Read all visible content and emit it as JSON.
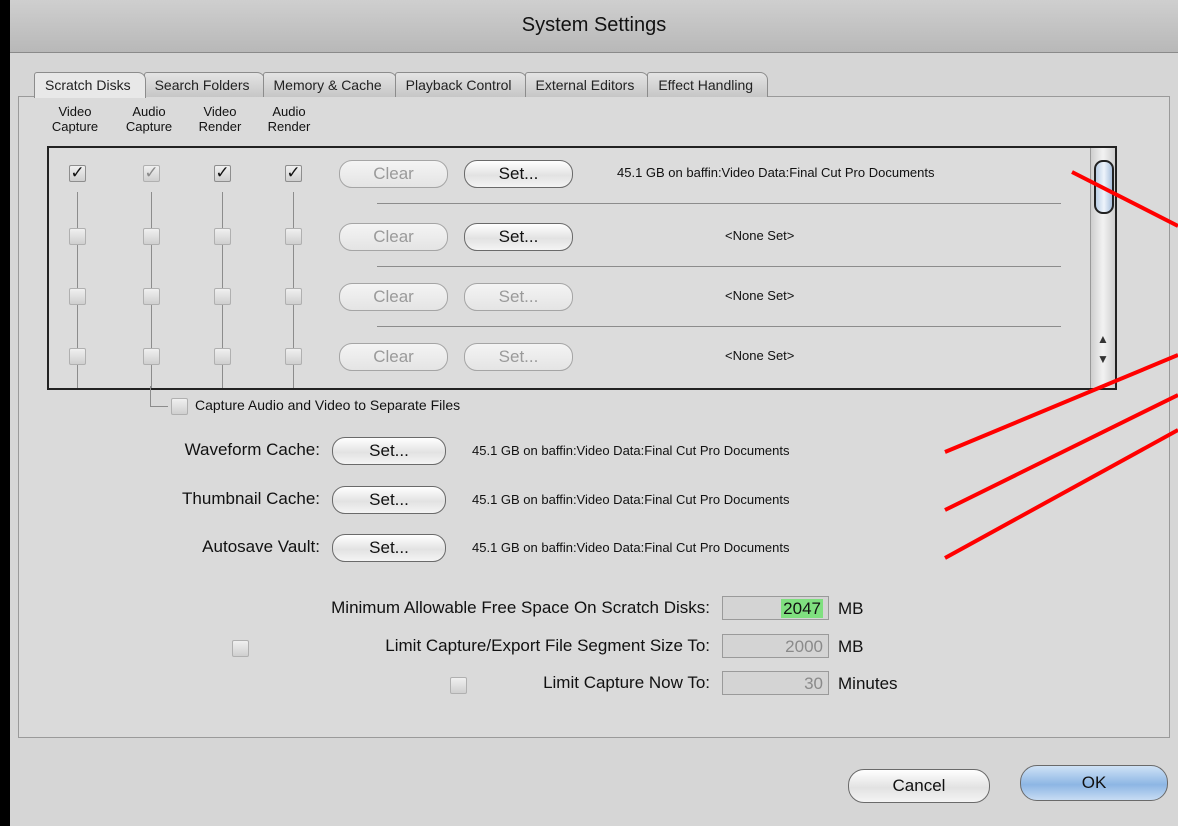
{
  "window": {
    "title": "System Settings"
  },
  "tabs": [
    {
      "label": "Scratch Disks",
      "active": true
    },
    {
      "label": "Search Folders"
    },
    {
      "label": "Memory & Cache"
    },
    {
      "label": "Playback Control"
    },
    {
      "label": "External Editors"
    },
    {
      "label": "Effect Handling"
    }
  ],
  "columns": [
    {
      "line1": "Video",
      "line2": "Capture"
    },
    {
      "line1": "Audio",
      "line2": "Capture"
    },
    {
      "line1": "Video",
      "line2": "Render"
    },
    {
      "line1": "Audio",
      "line2": "Render"
    }
  ],
  "scratch_rows": [
    {
      "checks": [
        true,
        true,
        true,
        true
      ],
      "check_disabled": [
        false,
        true,
        false,
        false
      ],
      "clear_label": "Clear",
      "set_label": "Set...",
      "set_enabled": true,
      "path": "45.1 GB on  baffin:Video Data:Final Cut Pro Documents"
    },
    {
      "checks": [
        false,
        false,
        false,
        false
      ],
      "clear_label": "Clear",
      "set_label": "Set...",
      "set_enabled": true,
      "path": "<None Set>"
    },
    {
      "checks": [
        false,
        false,
        false,
        false
      ],
      "clear_label": "Clear",
      "set_label": "Set...",
      "set_enabled": false,
      "path": "<None Set>"
    },
    {
      "checks": [
        false,
        false,
        false,
        false
      ],
      "clear_label": "Clear",
      "set_label": "Set...",
      "set_enabled": false,
      "path": "<None Set>"
    }
  ],
  "separate_files": {
    "label": "Capture Audio and Video to Separate Files",
    "checked": false
  },
  "caches": [
    {
      "label": "Waveform Cache:",
      "set_label": "Set...",
      "path": "45.1 GB on  baffin:Video Data:Final Cut Pro Documents"
    },
    {
      "label": "Thumbnail Cache:",
      "set_label": "Set...",
      "path": "45.1 GB on  baffin:Video Data:Final Cut Pro Documents"
    },
    {
      "label": "Autosave Vault:",
      "set_label": "Set...",
      "path": "45.1 GB on  baffin:Video Data:Final Cut Pro Documents"
    }
  ],
  "limits": {
    "min_free": {
      "label": "Minimum Allowable Free Space On Scratch Disks:",
      "value": "2047",
      "unit": "MB"
    },
    "segment": {
      "label": "Limit Capture/Export File Segment Size To:",
      "value": "2000",
      "unit": "MB",
      "checked": false
    },
    "capture_now": {
      "label": "Limit Capture Now To:",
      "value": "30",
      "unit": "Minutes",
      "checked": false
    }
  },
  "buttons": {
    "cancel": "Cancel",
    "ok": "OK"
  },
  "annotation_color": "#ff0000",
  "highlight_color": "#7fe07f"
}
